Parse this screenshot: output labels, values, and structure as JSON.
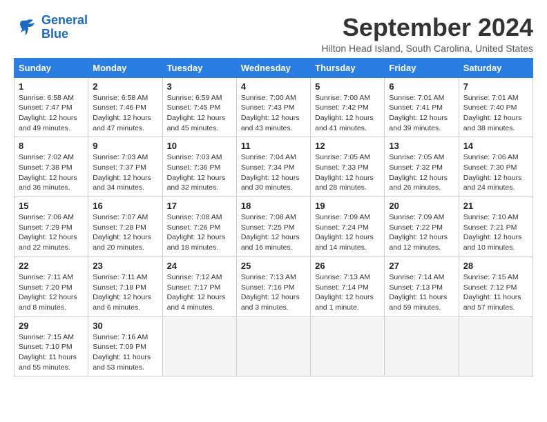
{
  "header": {
    "logo_line1": "General",
    "logo_line2": "Blue",
    "month_title": "September 2024",
    "subtitle": "Hilton Head Island, South Carolina, United States"
  },
  "weekdays": [
    "Sunday",
    "Monday",
    "Tuesday",
    "Wednesday",
    "Thursday",
    "Friday",
    "Saturday"
  ],
  "weeks": [
    [
      {
        "day": "1",
        "info": "Sunrise: 6:58 AM\nSunset: 7:47 PM\nDaylight: 12 hours\nand 49 minutes."
      },
      {
        "day": "2",
        "info": "Sunrise: 6:58 AM\nSunset: 7:46 PM\nDaylight: 12 hours\nand 47 minutes."
      },
      {
        "day": "3",
        "info": "Sunrise: 6:59 AM\nSunset: 7:45 PM\nDaylight: 12 hours\nand 45 minutes."
      },
      {
        "day": "4",
        "info": "Sunrise: 7:00 AM\nSunset: 7:43 PM\nDaylight: 12 hours\nand 43 minutes."
      },
      {
        "day": "5",
        "info": "Sunrise: 7:00 AM\nSunset: 7:42 PM\nDaylight: 12 hours\nand 41 minutes."
      },
      {
        "day": "6",
        "info": "Sunrise: 7:01 AM\nSunset: 7:41 PM\nDaylight: 12 hours\nand 39 minutes."
      },
      {
        "day": "7",
        "info": "Sunrise: 7:01 AM\nSunset: 7:40 PM\nDaylight: 12 hours\nand 38 minutes."
      }
    ],
    [
      {
        "day": "8",
        "info": "Sunrise: 7:02 AM\nSunset: 7:38 PM\nDaylight: 12 hours\nand 36 minutes."
      },
      {
        "day": "9",
        "info": "Sunrise: 7:03 AM\nSunset: 7:37 PM\nDaylight: 12 hours\nand 34 minutes."
      },
      {
        "day": "10",
        "info": "Sunrise: 7:03 AM\nSunset: 7:36 PM\nDaylight: 12 hours\nand 32 minutes."
      },
      {
        "day": "11",
        "info": "Sunrise: 7:04 AM\nSunset: 7:34 PM\nDaylight: 12 hours\nand 30 minutes."
      },
      {
        "day": "12",
        "info": "Sunrise: 7:05 AM\nSunset: 7:33 PM\nDaylight: 12 hours\nand 28 minutes."
      },
      {
        "day": "13",
        "info": "Sunrise: 7:05 AM\nSunset: 7:32 PM\nDaylight: 12 hours\nand 26 minutes."
      },
      {
        "day": "14",
        "info": "Sunrise: 7:06 AM\nSunset: 7:30 PM\nDaylight: 12 hours\nand 24 minutes."
      }
    ],
    [
      {
        "day": "15",
        "info": "Sunrise: 7:06 AM\nSunset: 7:29 PM\nDaylight: 12 hours\nand 22 minutes."
      },
      {
        "day": "16",
        "info": "Sunrise: 7:07 AM\nSunset: 7:28 PM\nDaylight: 12 hours\nand 20 minutes."
      },
      {
        "day": "17",
        "info": "Sunrise: 7:08 AM\nSunset: 7:26 PM\nDaylight: 12 hours\nand 18 minutes."
      },
      {
        "day": "18",
        "info": "Sunrise: 7:08 AM\nSunset: 7:25 PM\nDaylight: 12 hours\nand 16 minutes."
      },
      {
        "day": "19",
        "info": "Sunrise: 7:09 AM\nSunset: 7:24 PM\nDaylight: 12 hours\nand 14 minutes."
      },
      {
        "day": "20",
        "info": "Sunrise: 7:09 AM\nSunset: 7:22 PM\nDaylight: 12 hours\nand 12 minutes."
      },
      {
        "day": "21",
        "info": "Sunrise: 7:10 AM\nSunset: 7:21 PM\nDaylight: 12 hours\nand 10 minutes."
      }
    ],
    [
      {
        "day": "22",
        "info": "Sunrise: 7:11 AM\nSunset: 7:20 PM\nDaylight: 12 hours\nand 8 minutes."
      },
      {
        "day": "23",
        "info": "Sunrise: 7:11 AM\nSunset: 7:18 PM\nDaylight: 12 hours\nand 6 minutes."
      },
      {
        "day": "24",
        "info": "Sunrise: 7:12 AM\nSunset: 7:17 PM\nDaylight: 12 hours\nand 4 minutes."
      },
      {
        "day": "25",
        "info": "Sunrise: 7:13 AM\nSunset: 7:16 PM\nDaylight: 12 hours\nand 3 minutes."
      },
      {
        "day": "26",
        "info": "Sunrise: 7:13 AM\nSunset: 7:14 PM\nDaylight: 12 hours\nand 1 minute."
      },
      {
        "day": "27",
        "info": "Sunrise: 7:14 AM\nSunset: 7:13 PM\nDaylight: 11 hours\nand 59 minutes."
      },
      {
        "day": "28",
        "info": "Sunrise: 7:15 AM\nSunset: 7:12 PM\nDaylight: 11 hours\nand 57 minutes."
      }
    ],
    [
      {
        "day": "29",
        "info": "Sunrise: 7:15 AM\nSunset: 7:10 PM\nDaylight: 11 hours\nand 55 minutes."
      },
      {
        "day": "30",
        "info": "Sunrise: 7:16 AM\nSunset: 7:09 PM\nDaylight: 11 hours\nand 53 minutes."
      },
      {
        "day": "",
        "info": ""
      },
      {
        "day": "",
        "info": ""
      },
      {
        "day": "",
        "info": ""
      },
      {
        "day": "",
        "info": ""
      },
      {
        "day": "",
        "info": ""
      }
    ]
  ]
}
